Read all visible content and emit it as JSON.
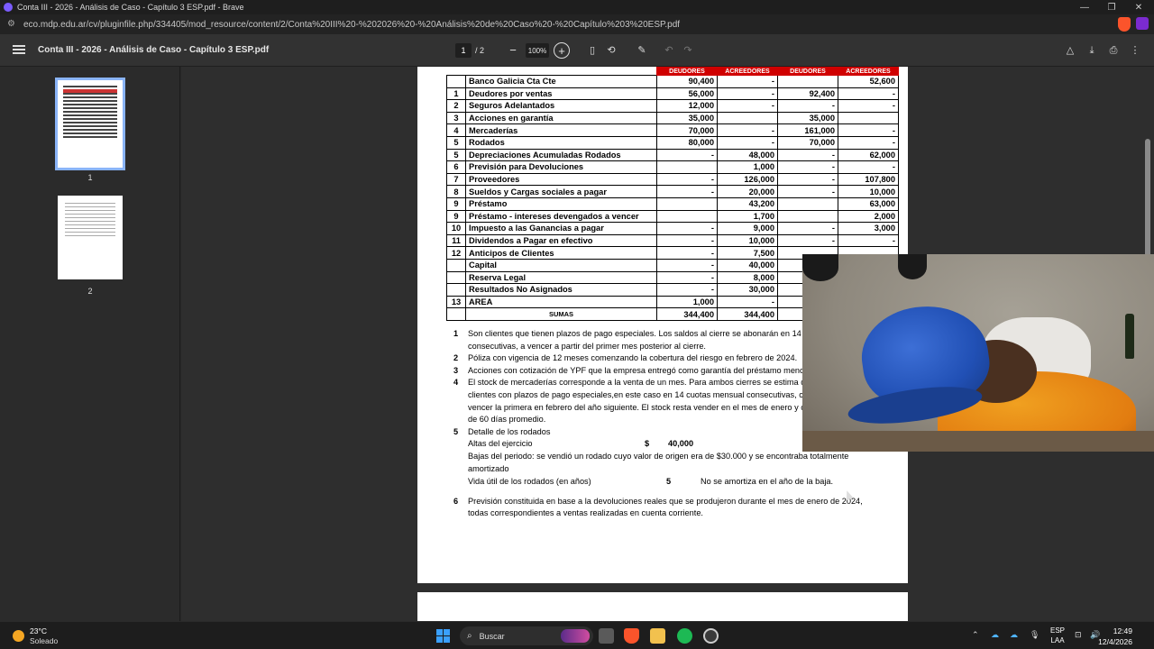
{
  "window": {
    "title": "Conta III - 2026 - Análisis de Caso - Capítulo 3 ESP.pdf - Brave",
    "url": "eco.mdp.edu.ar/cv/pluginfile.php/334405/mod_resource/content/2/Conta%20III%20-%202026%20-%20Análisis%20de%20Caso%20-%20Capítulo%203%20ESP.pdf",
    "minimize": "—",
    "restore": "❐",
    "close": "✕"
  },
  "pdf_toolbar": {
    "doc_title": "Conta III - 2026 - Análisis de Caso - Capítulo 3 ESP.pdf",
    "page_current": "1",
    "page_total": "/  2",
    "zoom_out": "−",
    "zoom": "100%",
    "zoom_in": "+"
  },
  "sidebar": {
    "thumbs": [
      {
        "label": "1"
      },
      {
        "label": "2"
      }
    ]
  },
  "table": {
    "headers": [
      "DEUDORES",
      "ACREEDORES",
      "DEUDORES",
      "ACREEDORES"
    ],
    "rows": [
      {
        "n": "",
        "cuenta": "Banco Galicia Cta Cte",
        "d1": "90,400",
        "a1": "-",
        "d2": "",
        "a2": "52,600"
      },
      {
        "n": "1",
        "cuenta": "Deudores por ventas",
        "d1": "56,000",
        "a1": "-",
        "d2": "92,400",
        "a2": "-"
      },
      {
        "n": "2",
        "cuenta": "Seguros Adelantados",
        "d1": "12,000",
        "a1": "-",
        "d2": "-",
        "a2": "-"
      },
      {
        "n": "3",
        "cuenta": "Acciones en garantía",
        "d1": "35,000",
        "a1": "",
        "d2": "35,000",
        "a2": ""
      },
      {
        "n": "4",
        "cuenta": "Mercaderías",
        "d1": "70,000",
        "a1": "-",
        "d2": "161,000",
        "a2": "-"
      },
      {
        "n": "5",
        "cuenta": "Rodados",
        "d1": "80,000",
        "a1": "-",
        "d2": "70,000",
        "a2": "-"
      },
      {
        "n": "5",
        "cuenta": "Depreciaciones Acumuladas Rodados",
        "d1": "-",
        "a1": "48,000",
        "d2": "-",
        "a2": "62,000"
      },
      {
        "n": "6",
        "cuenta": "Previsión para Devoluciones",
        "d1": "",
        "a1": "1,000",
        "d2": "-",
        "a2": "-"
      },
      {
        "n": "7",
        "cuenta": "Proveedores",
        "d1": "-",
        "a1": "126,000",
        "d2": "-",
        "a2": "107,800"
      },
      {
        "n": "8",
        "cuenta": "Sueldos y Cargas sociales a pagar",
        "d1": "-",
        "a1": "20,000",
        "d2": "-",
        "a2": "10,000"
      },
      {
        "n": "9",
        "cuenta": "Préstamo",
        "d1": "",
        "a1": "43,200",
        "d2": "",
        "a2": "63,000"
      },
      {
        "n": "9",
        "cuenta": "Préstamo - intereses devengados a vencer",
        "d1": "",
        "a1": "1,700",
        "d2": "",
        "a2": "2,000"
      },
      {
        "n": "10",
        "cuenta": "Impuesto a las Ganancias a pagar",
        "d1": "-",
        "a1": "9,000",
        "d2": "-",
        "a2": "3,000"
      },
      {
        "n": "11",
        "cuenta": "Dividendos a Pagar en efectivo",
        "d1": "-",
        "a1": "10,000",
        "d2": "-",
        "a2": "-"
      },
      {
        "n": "12",
        "cuenta": "Anticipos de Clientes",
        "d1": "-",
        "a1": "7,500",
        "d2": "",
        "a2": ""
      },
      {
        "n": "",
        "cuenta": "Capital",
        "d1": "-",
        "a1": "40,000",
        "d2": "",
        "a2": ""
      },
      {
        "n": "",
        "cuenta": "Reserva Legal",
        "d1": "-",
        "a1": "8,000",
        "d2": "",
        "a2": ""
      },
      {
        "n": "",
        "cuenta": "Resultados No Asignados",
        "d1": "-",
        "a1": "30,000",
        "d2": "",
        "a2": ""
      },
      {
        "n": "13",
        "cuenta": "AREA",
        "d1": "1,000",
        "a1": "-",
        "d2": "",
        "a2": ""
      }
    ],
    "sumas": {
      "label": "SUMAS",
      "d1": "344,400",
      "a1": "344,400",
      "d2": "358,4",
      "a2": ""
    }
  },
  "notes": {
    "n1": {
      "num": "1",
      "text": "Son clientes que tienen plazos de pago especiales. Los saldos al cierre se abonarán en 14 c iguales y consecutivas, a vencer a partir del primer mes posterior al cierre."
    },
    "n2": {
      "num": "2",
      "text": "Póliza con vigencia de 12 meses comenzando la cobertura del riesgo en febrero de 2024."
    },
    "n3": {
      "num": "3",
      "text": "Acciones con cotización de YPF que la empresa entregó como garantía del préstamo menc 9."
    },
    "n4": {
      "num": "4",
      "text": "El stock de mercaderías corresponde a la venta de un mes. Para ambos cierres se estima q se venderá a los clientes con plazos de pago especiales,en este caso en 14 cuotas mensual consecutivas, comenzando a vencer la primera en febrero del año siguiente. El stock resta vender en el mes de enero y cobrar en el plazo de 60 días promedio."
    },
    "n5": {
      "num": "5",
      "title": "Detalle de los rodados",
      "altas_label": "Altas del ejercicio",
      "altas_currency": "$",
      "altas_value": "40,000",
      "bajas": "Bajas del periodo: se vendió un rodado cuyo valor de origen era de $30.000 y se encontraba totalmente amortizado",
      "vida_label": "Vida útil de los rodados (en años)",
      "vida_value": "5",
      "vida_note": "No se amortiza en el año de la baja."
    },
    "n6": {
      "num": "6",
      "text": "Previsión constituida en base a la devoluciones reales que se produjeron durante el mes de enero de 2024, todas correspondientes a ventas realizadas en cuenta corriente."
    }
  },
  "taskbar": {
    "weather_temp": "23°C",
    "weather_desc": "Soleado",
    "search": "Buscar",
    "lang1": "ESP",
    "lang2": "LAA",
    "time": "12:49",
    "date": "12/4/2026"
  },
  "colors": {
    "header_red": "#d00000",
    "accent": "#8ab4f8",
    "brave": "#fb542b"
  }
}
